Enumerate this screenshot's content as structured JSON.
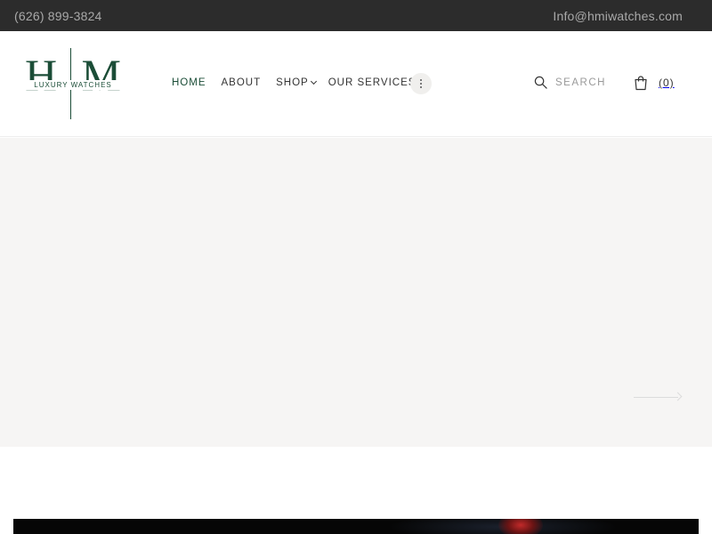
{
  "topbar": {
    "phone": "(626) 899-3824",
    "email": "Info@hmiwatches.com"
  },
  "logo": {
    "letter_left": "H",
    "letter_right": "M",
    "tagline": "LUXURY WATCHES",
    "color": "#1b4d37"
  },
  "nav": {
    "items": [
      {
        "label": "HOME",
        "active": true
      },
      {
        "label": "ABOUT"
      },
      {
        "label": "SHOP",
        "has_dropdown": true
      },
      {
        "label": "OUR SERVICES"
      }
    ],
    "more_icon": "vertical-dots-icon"
  },
  "search": {
    "placeholder": "SEARCH",
    "icon": "search-icon"
  },
  "cart": {
    "icon": "shopping-bag-icon",
    "count": "(0)"
  },
  "hero": {
    "next_icon": "arrow-right-icon"
  },
  "colors": {
    "brand": "#1b4d37",
    "topbar_bg": "#2c2c2c",
    "hero_bg": "#f6f5f4"
  }
}
